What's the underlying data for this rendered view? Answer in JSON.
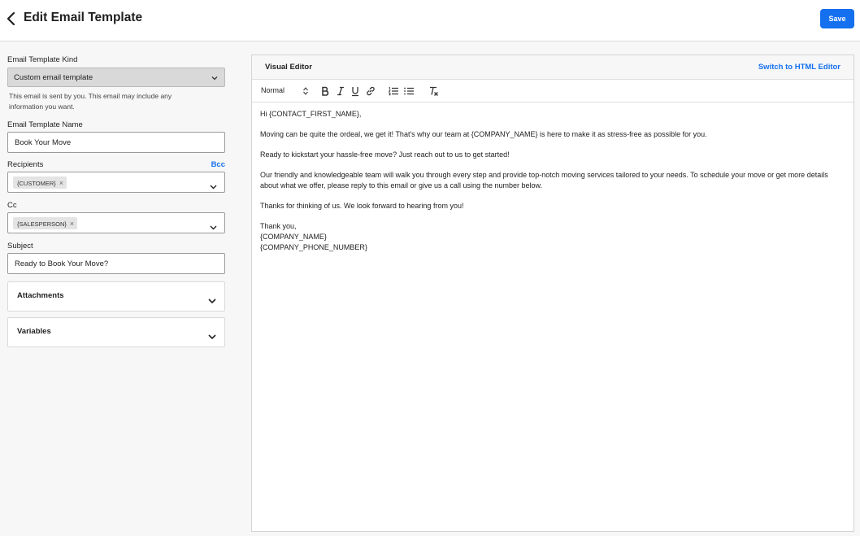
{
  "header": {
    "title": "Edit Email Template",
    "save_label": "Save"
  },
  "form": {
    "kind_label": "Email Template Kind",
    "kind_value": "Custom email template",
    "kind_helper": "This email is sent by you. This email may include any information you want.",
    "name_label": "Email Template Name",
    "name_value": "Book Your Move",
    "recipients_label": "Recipients",
    "bcc_label": "Bcc",
    "recipients_chip": "{CUSTOMER}",
    "cc_label": "Cc",
    "cc_chip": "{SALESPERSON}",
    "subject_label": "Subject",
    "subject_value": "Ready to Book Your Move?",
    "chip_remove": "×",
    "accordions": [
      {
        "title": "Attachments"
      },
      {
        "title": "Variables"
      }
    ]
  },
  "editor": {
    "title": "Visual Editor",
    "switch_label": "Switch to HTML Editor",
    "format_value": "Normal",
    "toolbar_icons": [
      "bold-icon",
      "italic-icon",
      "underline-icon",
      "link-icon",
      "ordered-list-icon",
      "bullet-list-icon",
      "clear-format-icon"
    ],
    "body": {
      "p1": "Hi {CONTACT_FIRST_NAME},",
      "p2": "Moving can be quite the ordeal, we get it! That's why our team at {COMPANY_NAME} is here to make it as stress-free as possible for you.",
      "p3": "Ready to kickstart your hassle-free move? Just reach out to us to get started!",
      "p4": "Our friendly and knowledgeable team will walk you through every step and provide top-notch moving services tailored to your needs. To schedule your move or get more details about what we offer, please reply to this email or give us a call using the number below.",
      "p5": "Thanks for thinking of us. We look forward to hearing from you!",
      "sig1": "Thank you,",
      "sig2": "{COMPANY_NAME}",
      "sig3": "{COMPANY_PHONE_NUMBER}"
    }
  },
  "colors": {
    "accent": "#1570ef",
    "select_bg": "#d9d9d9"
  }
}
